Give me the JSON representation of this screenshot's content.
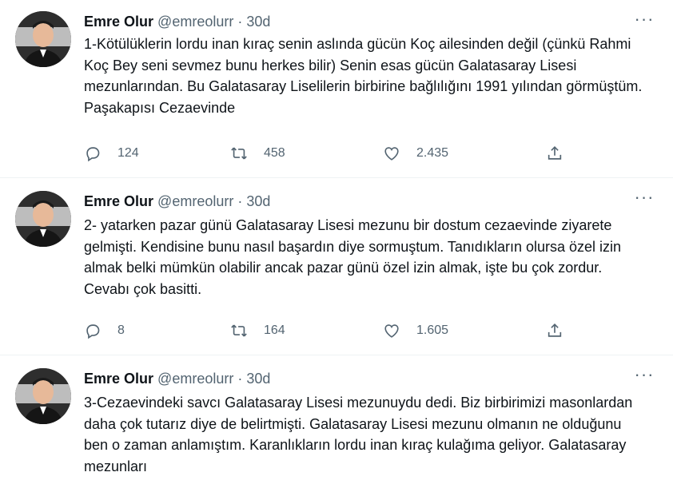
{
  "tweets": [
    {
      "name": "Emre Olur",
      "handle": "@emreolurr",
      "separator": "·",
      "time": "30d",
      "text": "1-Kötülüklerin lordu inan kıraç senin aslında gücün Koç ailesinden değil (çünkü Rahmi Koç Bey seni sevmez bunu herkes bilir) Senin esas gücün Galatasaray Lisesi mezunlarından. Bu Galatasaray Liselilerin birbirine bağlılığını 1991 yılından görmüştüm. Paşakapısı Cezaevinde",
      "replies": "124",
      "retweets": "458",
      "likes": "2.435",
      "more": "···"
    },
    {
      "name": "Emre Olur",
      "handle": "@emreolurr",
      "separator": "·",
      "time": "30d",
      "text": "2- yatarken pazar günü Galatasaray Lisesi mezunu bir dostum cezaevinde ziyarete gelmişti. Kendisine bunu nasıl başardın diye sormuştum. Tanıdıkların olursa özel izin almak belki mümkün olabilir ancak pazar günü özel izin almak, işte bu çok zordur. Cevabı çok basitti.",
      "replies": "8",
      "retweets": "164",
      "likes": "1.605",
      "more": "···"
    },
    {
      "name": "Emre Olur",
      "handle": "@emreolurr",
      "separator": "·",
      "time": "30d",
      "text": "3-Cezaevindeki savcı Galatasaray Lisesi mezunuydu dedi. Biz birbirimizi masonlardan daha çok tutarız diye de belirtmişti. Galatasaray Lisesi mezunu olmanın ne olduğunu ben o zaman anlamıştım. Karanlıkların lordu inan kıraç kulağıma geliyor. Galatasaray mezunları",
      "more": "···"
    }
  ],
  "icons": {
    "reply": "reply-icon",
    "retweet": "retweet-icon",
    "like": "heart-icon",
    "share": "share-icon",
    "more": "more-icon"
  },
  "colors": {
    "text": "#0f1419",
    "secondary": "#536471",
    "divider": "#eff3f4",
    "background": "#ffffff"
  }
}
